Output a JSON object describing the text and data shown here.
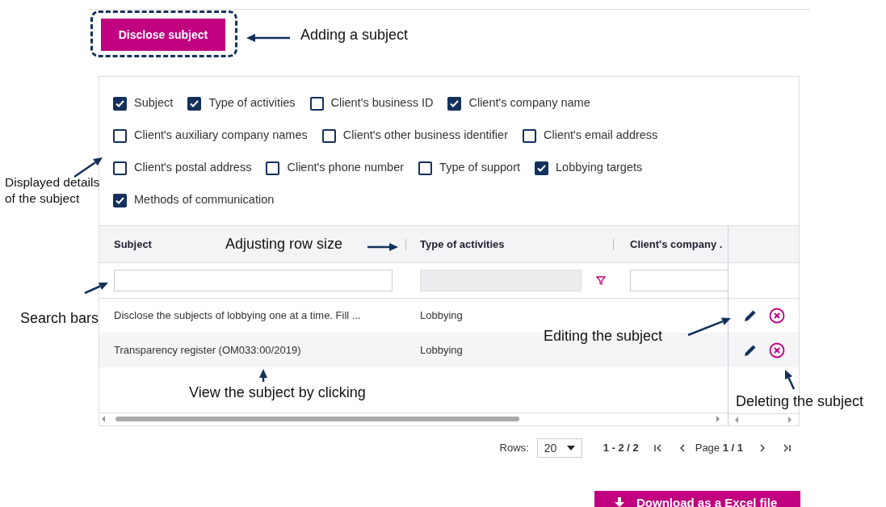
{
  "add_button": {
    "label": "Disclose subject"
  },
  "detail_options": [
    {
      "options": [
        {
          "label": "Subject",
          "checked": true
        },
        {
          "label": "Type of activities",
          "checked": true
        },
        {
          "label": "Client's business ID",
          "checked": false
        },
        {
          "label": "Client's company name",
          "checked": true
        }
      ]
    },
    {
      "options": [
        {
          "label": "Client's auxiliary company names",
          "checked": false
        },
        {
          "label": "Client's other business identifier",
          "checked": false
        },
        {
          "label": "Client's email address",
          "checked": false
        }
      ]
    },
    {
      "options": [
        {
          "label": "Client's postal address",
          "checked": false
        },
        {
          "label": "Client's phone number",
          "checked": false
        },
        {
          "label": "Type of support",
          "checked": false
        },
        {
          "label": "Lobbying targets",
          "checked": true
        }
      ]
    },
    {
      "options": [
        {
          "label": "Methods of communication",
          "checked": true
        }
      ]
    }
  ],
  "table": {
    "columns": [
      {
        "label": "Subject",
        "kind": "text",
        "disabled": false
      },
      {
        "label": "Type of activities",
        "kind": "dropdown",
        "disabled": true
      },
      {
        "label": "Client's company .",
        "kind": "text",
        "disabled": false
      }
    ],
    "rows": [
      {
        "cells": [
          "Disclose the subjects of lobbying one at a time. Fill ...",
          "Lobbying"
        ]
      },
      {
        "cells": [
          "Transparency register (OM033:00/2019)",
          "Lobbying"
        ]
      }
    ]
  },
  "pagination": {
    "rows_label": "Rows:",
    "rows_value": "20",
    "range": "1 - 2 / 2",
    "page": "Page **1 / 1**"
  },
  "download_button": {
    "label": "Download as a Excel file"
  },
  "annotations": [
    {
      "text": "Adding a subject"
    },
    {
      "text": "Displayed details of the subject"
    },
    {
      "text": "Adjusting row size"
    },
    {
      "text": "Search bars"
    },
    {
      "text": "View the subject by clicking"
    },
    {
      "text": "Editing the subject"
    },
    {
      "text": "Deleting the subject"
    }
  ]
}
